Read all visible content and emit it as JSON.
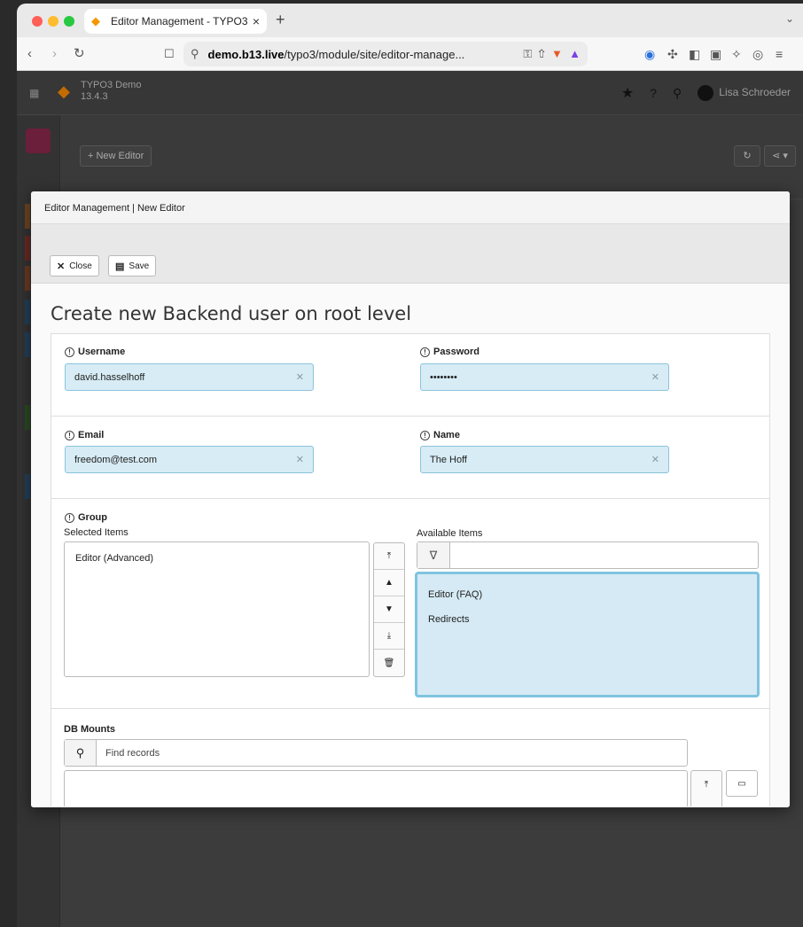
{
  "browser": {
    "tab_title": "Editor Management - TYPO3 |",
    "tab_close": "×",
    "new_tab": "+",
    "tabs_menu": "⌄",
    "url_host": "demo.b13.live",
    "url_path": "/typo3/module/site/editor-manage..."
  },
  "typo3": {
    "site_name": "TYPO3 Demo",
    "version": "13.4.3",
    "user_name": "Lisa Schroeder",
    "new_editor_label": "New Editor"
  },
  "modal": {
    "title": "Editor Management | New Editor",
    "close_label": "Close",
    "save_label": "Save",
    "page_title": "Create new Backend user on root level",
    "username": {
      "label": "Username",
      "value": "david.hasselhoff"
    },
    "password": {
      "label": "Password",
      "value": "••••••••"
    },
    "email": {
      "label": "Email",
      "value": "freedom@test.com"
    },
    "name": {
      "label": "Name",
      "value": "The Hoff"
    },
    "group": {
      "label": "Group",
      "selected_label": "Selected Items",
      "available_label": "Available Items",
      "selected_items": [
        "Editor (Advanced)"
      ],
      "available_items": [
        "Editor (FAQ)",
        "Redirects"
      ]
    },
    "db_mounts": {
      "label": "DB Mounts",
      "search_placeholder": "Find records"
    }
  },
  "colors": {
    "input_bg": "#d7ecf5",
    "input_border": "#8ac3db",
    "focus_border": "#7fc4e0",
    "typo3_orange": "#f49700"
  }
}
